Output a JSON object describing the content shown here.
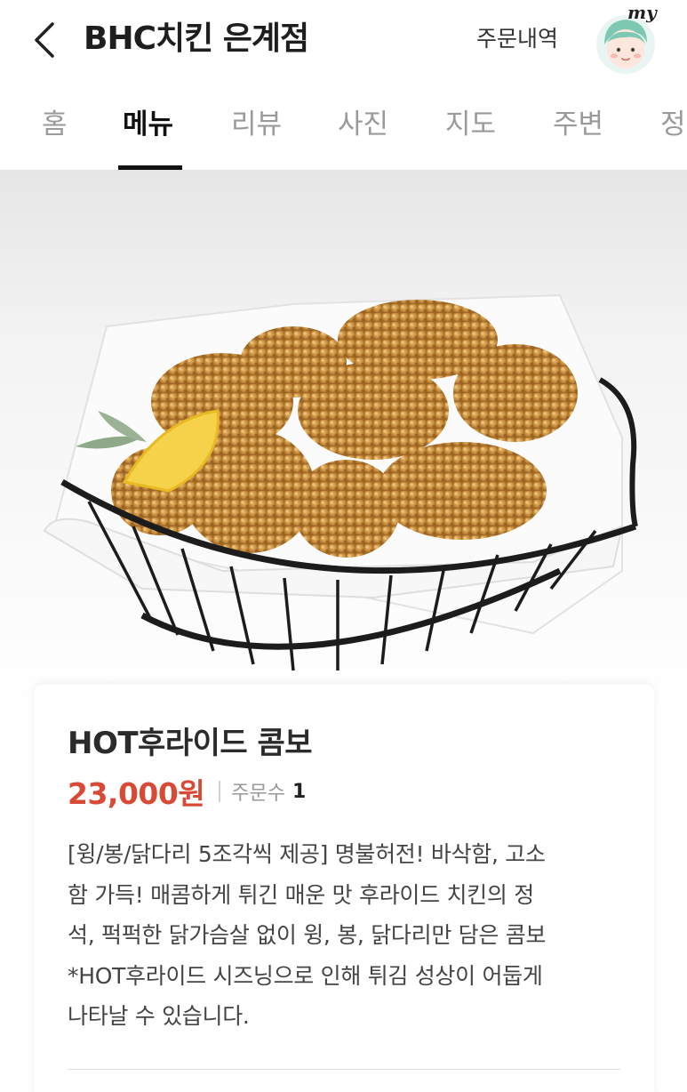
{
  "header": {
    "back_icon": "chevron-left-icon",
    "title": "BHC치킨 은계점",
    "order_history": "주문내역",
    "my_label": "my"
  },
  "tabs": [
    {
      "label": "홈",
      "active": false
    },
    {
      "label": "메뉴",
      "active": true
    },
    {
      "label": "리뷰",
      "active": false
    },
    {
      "label": "사진",
      "active": false
    },
    {
      "label": "지도",
      "active": false
    },
    {
      "label": "주변",
      "active": false
    },
    {
      "label": "정",
      "active": false
    }
  ],
  "product": {
    "name": "HOT후라이드 콤보",
    "price": "23,000원",
    "order_count_label": "주문수",
    "order_count_value": "1",
    "description_lines": [
      "[윙/봉/닭다리 5조각씩 제공] 명불허전! 바삭함, 고소",
      "함 가득! 매콤하게 튀긴 매운 맛 후라이드 치킨의 정",
      "석, 퍽퍽한 닭가슴살 없이 윙, 봉, 닭다리만 담은 콤보",
      "*HOT후라이드 시즈닝으로 인해 튀김 성상이 어둡게",
      "나타날 수 있습니다."
    ]
  },
  "colors": {
    "price": "#d94a36",
    "active_tab": "#111111",
    "inactive_tab": "#9a9a9a"
  }
}
